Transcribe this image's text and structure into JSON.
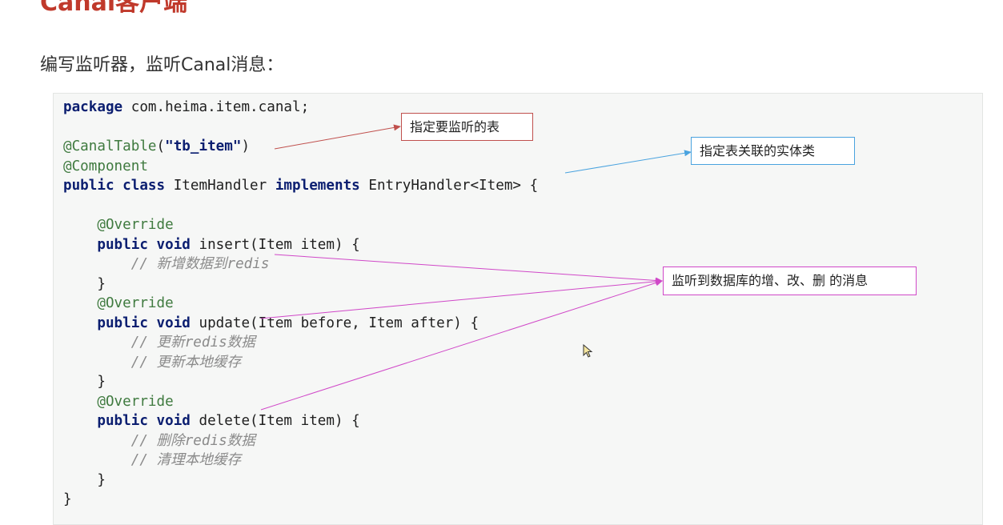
{
  "page": {
    "title": "Canal客户端",
    "subtitle": "编写监听器，监听Canal消息："
  },
  "code": {
    "lines": [
      [
        {
          "t": "package",
          "c": "kw"
        },
        {
          "t": " com.heima.item.canal;"
        }
      ],
      [],
      [
        {
          "t": "@CanalTable",
          "c": "ann"
        },
        {
          "t": "("
        },
        {
          "t": "\"tb_item\"",
          "c": "str"
        },
        {
          "t": ")"
        }
      ],
      [
        {
          "t": "@Component",
          "c": "ann"
        }
      ],
      [
        {
          "t": "public",
          "c": "kw"
        },
        {
          "t": " "
        },
        {
          "t": "class",
          "c": "kw"
        },
        {
          "t": " ItemHandler "
        },
        {
          "t": "implements",
          "c": "kw"
        },
        {
          "t": " EntryHandler<Item> {"
        }
      ],
      [],
      [
        {
          "t": "    "
        },
        {
          "t": "@Override",
          "c": "ann"
        }
      ],
      [
        {
          "t": "    "
        },
        {
          "t": "public",
          "c": "kw"
        },
        {
          "t": " "
        },
        {
          "t": "void",
          "c": "kw"
        },
        {
          "t": " insert(Item item) {"
        }
      ],
      [
        {
          "t": "        "
        },
        {
          "t": "// 新增数据到redis",
          "c": "cmt"
        }
      ],
      [
        {
          "t": "    }"
        }
      ],
      [
        {
          "t": "    "
        },
        {
          "t": "@Override",
          "c": "ann"
        }
      ],
      [
        {
          "t": "    "
        },
        {
          "t": "public",
          "c": "kw"
        },
        {
          "t": " "
        },
        {
          "t": "void",
          "c": "kw"
        },
        {
          "t": " update(Item before, Item after) {"
        }
      ],
      [
        {
          "t": "        "
        },
        {
          "t": "// 更新redis数据",
          "c": "cmt"
        }
      ],
      [
        {
          "t": "        "
        },
        {
          "t": "// 更新本地缓存",
          "c": "cmt"
        }
      ],
      [
        {
          "t": "    }"
        }
      ],
      [
        {
          "t": "    "
        },
        {
          "t": "@Override",
          "c": "ann"
        }
      ],
      [
        {
          "t": "    "
        },
        {
          "t": "public",
          "c": "kw"
        },
        {
          "t": " "
        },
        {
          "t": "void",
          "c": "kw"
        },
        {
          "t": " delete(Item item) {"
        }
      ],
      [
        {
          "t": "        "
        },
        {
          "t": "// 删除redis数据",
          "c": "cmt"
        }
      ],
      [
        {
          "t": "        "
        },
        {
          "t": "// 清理本地缓存",
          "c": "cmt"
        }
      ],
      [
        {
          "t": "    }"
        }
      ],
      [
        {
          "t": "}"
        }
      ]
    ]
  },
  "callouts": {
    "table": "指定要监听的表",
    "entity": "指定表关联的实体类",
    "events": "监听到数据库的增、改、删  的消息"
  },
  "colors": {
    "title": "#c0392b",
    "keyword": "#0b1e70",
    "annotation": "#3f7a3f",
    "comment": "#8a8a8a",
    "arrow_red": "#c0504d",
    "arrow_blue": "#4aa3df",
    "arrow_magenta": "#d048c8"
  }
}
